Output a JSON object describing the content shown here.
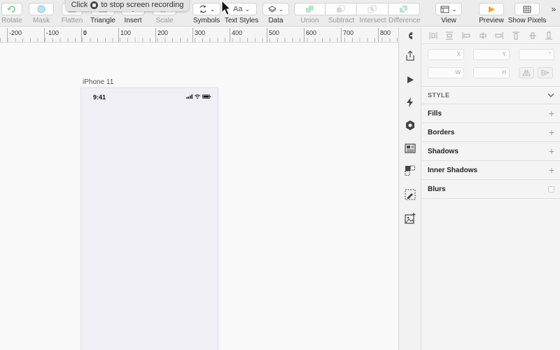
{
  "recording_tip": {
    "before": "Click",
    "after": "to stop screen recording"
  },
  "toolbar": {
    "rotate": "Rotate",
    "mask": "Mask",
    "flatten": "Flatten",
    "triangle": "Triangle",
    "insert": "Insert",
    "scale": "Scale",
    "symbols": "Symbols",
    "text_styles": "Text Styles",
    "text_styles_icon_text": "Aa",
    "data": "Data",
    "union": "Union",
    "subtract": "Subtract",
    "intersect": "Intersect",
    "difference": "Difference",
    "view": "View",
    "preview": "Preview",
    "show_pixels": "Show Pixels",
    "more": "»"
  },
  "ruler": {
    "labels": [
      "-200",
      "-100",
      "0",
      "100",
      "200",
      "300",
      "400",
      "500",
      "600",
      "700",
      "800"
    ]
  },
  "artboard": {
    "name": "iPhone 11",
    "time": "9:41"
  },
  "inspector": {
    "fields": {
      "x": "X",
      "y": "Y",
      "rotation": "°",
      "w": "W",
      "h": "H"
    },
    "style_header": "STYLE",
    "sections": {
      "fills": "Fills",
      "borders": "Borders",
      "shadows": "Shadows",
      "inner_shadows": "Inner Shadows",
      "blurs": "Blurs"
    }
  },
  "colors": {
    "accent_orange": "#f5a623",
    "boolean_green": "#7ed6a5",
    "toolbar_bg": "#ececec",
    "artboard_bg": "#f0eff6"
  }
}
